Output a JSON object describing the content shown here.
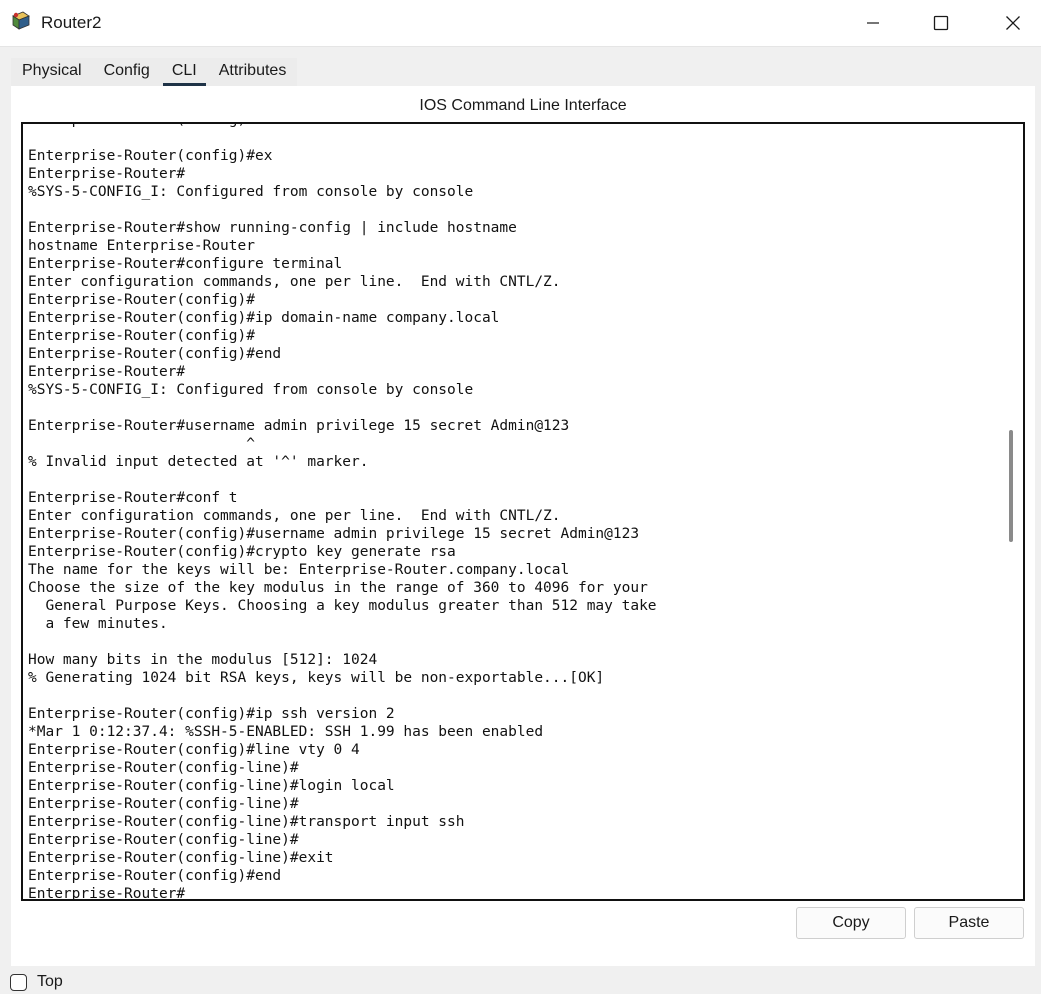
{
  "window": {
    "title": "Router2",
    "icon": "router-icon",
    "controls": [
      "minimize-icon",
      "maximize-icon",
      "close-icon"
    ]
  },
  "tabs": [
    {
      "label": "Physical",
      "active": false
    },
    {
      "label": "Config",
      "active": false
    },
    {
      "label": "CLI",
      "active": true
    },
    {
      "label": "Attributes",
      "active": false
    }
  ],
  "panel": {
    "title": "IOS Command Line Interface"
  },
  "terminal": {
    "text": "Enterprise-Router(config)#\n\nEnterprise-Router(config)#ex\nEnterprise-Router#\n%SYS-5-CONFIG_I: Configured from console by console\n\nEnterprise-Router#show running-config | include hostname\nhostname Enterprise-Router\nEnterprise-Router#configure terminal\nEnter configuration commands, one per line.  End with CNTL/Z.\nEnterprise-Router(config)#\nEnterprise-Router(config)#ip domain-name company.local\nEnterprise-Router(config)#\nEnterprise-Router(config)#end\nEnterprise-Router#\n%SYS-5-CONFIG_I: Configured from console by console\n\nEnterprise-Router#username admin privilege 15 secret Admin@123\n                         ^\n% Invalid input detected at '^' marker.\n\nEnterprise-Router#conf t\nEnter configuration commands, one per line.  End with CNTL/Z.\nEnterprise-Router(config)#username admin privilege 15 secret Admin@123\nEnterprise-Router(config)#crypto key generate rsa\nThe name for the keys will be: Enterprise-Router.company.local\nChoose the size of the key modulus in the range of 360 to 4096 for your\n  General Purpose Keys. Choosing a key modulus greater than 512 may take\n  a few minutes.\n\nHow many bits in the modulus [512]: 1024\n% Generating 1024 bit RSA keys, keys will be non-exportable...[OK]\n\nEnterprise-Router(config)#ip ssh version 2\n*Mar 1 0:12:37.4: %SSH-5-ENABLED: SSH 1.99 has been enabled\nEnterprise-Router(config)#line vty 0 4\nEnterprise-Router(config-line)#\nEnterprise-Router(config-line)#login local\nEnterprise-Router(config-line)#\nEnterprise-Router(config-line)#transport input ssh\nEnterprise-Router(config-line)#\nEnterprise-Router(config-line)#exit\nEnterprise-Router(config)#end\nEnterprise-Router#"
  },
  "buttons": {
    "copy": "Copy",
    "paste": "Paste"
  },
  "footer": {
    "top_checkbox_label": "Top",
    "top_checked": false
  }
}
